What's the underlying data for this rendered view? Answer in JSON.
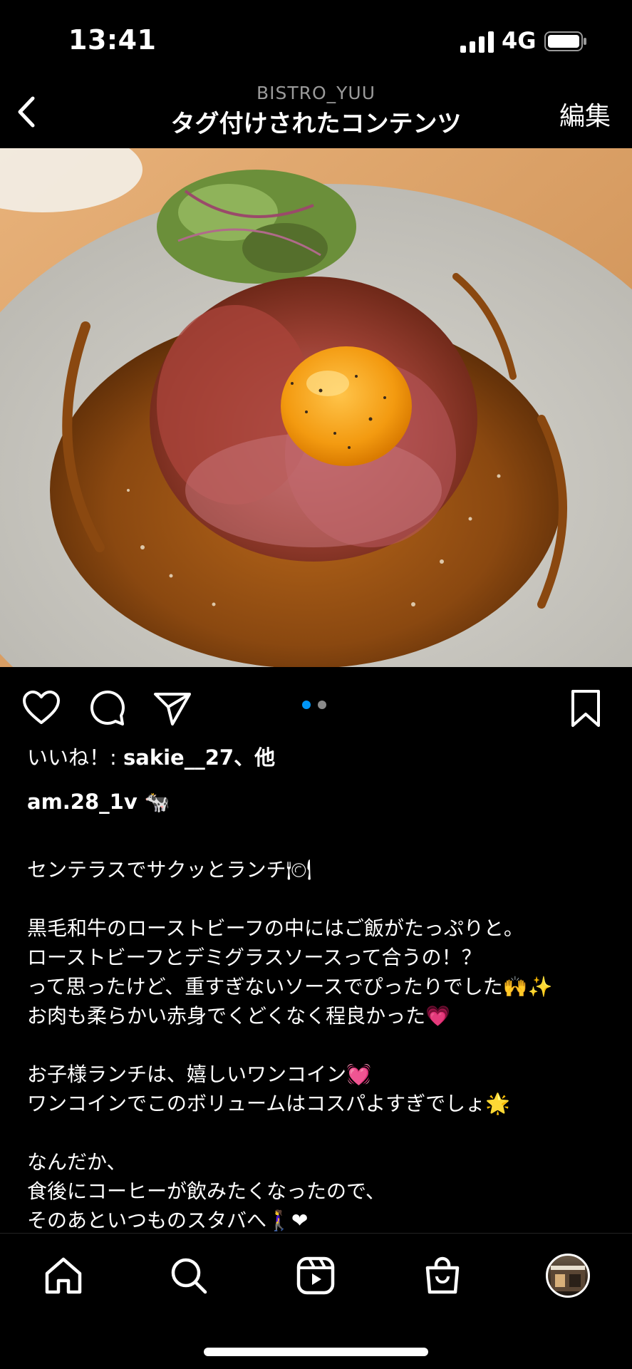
{
  "status_bar": {
    "time": "13:41",
    "network": "4G"
  },
  "header": {
    "account": "BISTRO_YUU",
    "title": "タグ付けされたコンテンツ",
    "edit_label": "編集"
  },
  "post": {
    "carousel": {
      "count": 2,
      "active_index": 0
    },
    "likes_prefix": "いいね！: ",
    "likes_user": "sakie__27",
    "likes_suffix": "、他",
    "author": "am.28_1v 🐄",
    "caption": "センテラスでサクッとランチ🍽\n\n黒毛和牛のローストビーフの中にはご飯がたっぷりと。\nローストビーフとデミグラスソースって合うの！？\nって思ったけど、重すぎないソースでぴったりでした🙌✨\nお肉も柔らかい赤身でくどくなく程良かった💗\n\nお子様ランチは、嬉しいワンコイン💓\nワンコインでこのボリュームはコスパよすぎでしょ🌟\n\nなんだか、\n食後にコーヒーが飲みたくなったので、\nそのあといつものスタバへ🚶‍♀️❤"
  },
  "colors": {
    "background": "#000000",
    "accent": "#0095f6",
    "subtle": "#9a9a9a"
  },
  "tab_bar": [
    "home-icon",
    "search-icon",
    "reels-icon",
    "shop-icon",
    "profile-avatar"
  ]
}
